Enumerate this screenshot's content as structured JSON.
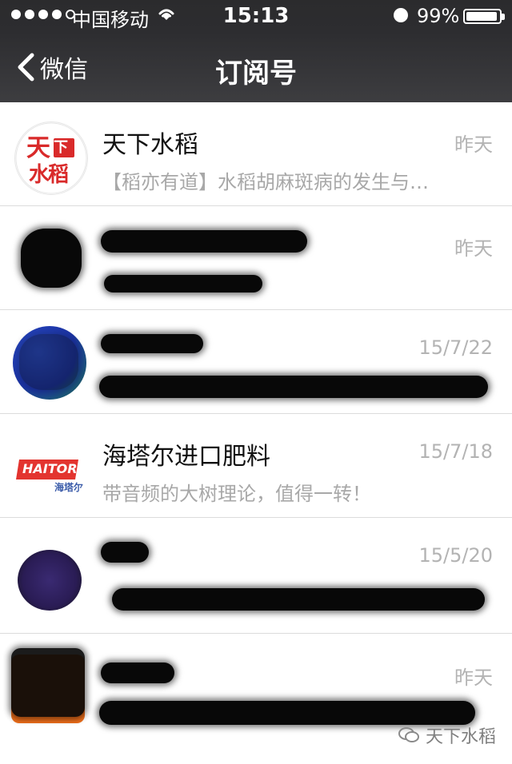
{
  "status": {
    "carrier": "中国移动",
    "time": "15:13",
    "battery_percent": "99%"
  },
  "nav": {
    "back_label": "微信",
    "title": "订阅号"
  },
  "rows": [
    {
      "avatar_text_top": "下",
      "avatar_text_bottom": "水稻",
      "name": "天下水稻",
      "time": "昨天",
      "preview": "【稻亦有道】水稻胡麻斑病的发生与…"
    },
    {
      "time": "昨天"
    },
    {
      "time": "15/7/22"
    },
    {
      "name": "海塔尔进口肥料",
      "time": "15/7/18",
      "preview": "带音频的大树理论，值得一转！",
      "logo": "HAITOR",
      "logo_sub": "海塔尔"
    },
    {
      "time": "15/5/20"
    },
    {
      "time": "昨天"
    }
  ],
  "watermark": "天下水稻"
}
